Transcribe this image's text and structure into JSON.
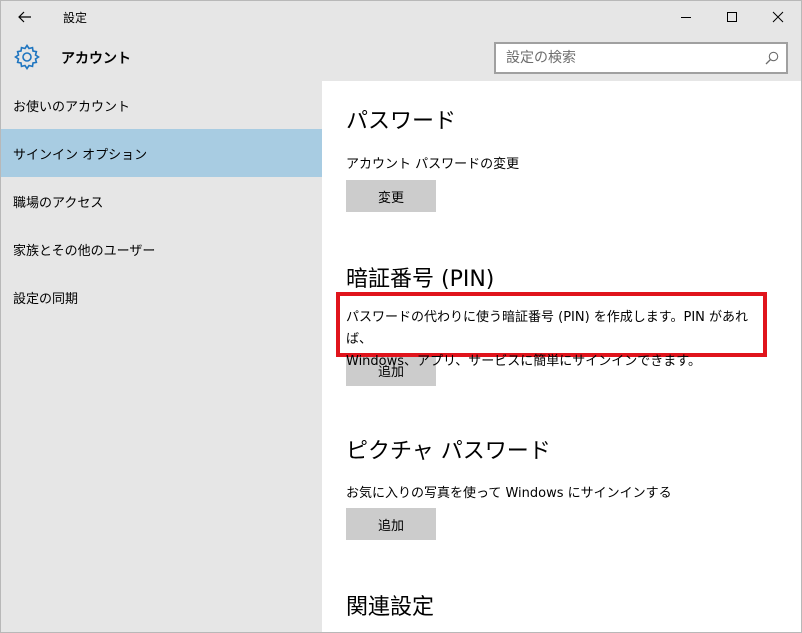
{
  "titlebar": {
    "title": "設定",
    "back_icon": "arrow-left-icon",
    "minimize_icon": "minimize-icon",
    "maximize_icon": "maximize-icon",
    "close_icon": "close-icon"
  },
  "header": {
    "title": "アカウント",
    "icon": "gear-icon",
    "accent_color": "#1e75c0"
  },
  "search": {
    "placeholder": "設定の検索",
    "value": "",
    "icon": "search-icon"
  },
  "sidebar": {
    "items": [
      {
        "label": "お使いのアカウント",
        "selected": false
      },
      {
        "label": "サインイン オプション",
        "selected": true
      },
      {
        "label": "職場のアクセス",
        "selected": false
      },
      {
        "label": "家族とその他のユーザー",
        "selected": false
      },
      {
        "label": "設定の同期",
        "selected": false
      }
    ],
    "selected_color": "#a8cce2"
  },
  "content": {
    "password": {
      "heading": "パスワード",
      "subtitle": "アカウント パスワードの変更",
      "button": "変更"
    },
    "pin": {
      "heading": "暗証番号 (PIN)",
      "description_line1": "パスワードの代わりに使う暗証番号 (PIN) を作成します。PIN があれば、",
      "description_line2": "Windows、アプリ、サービスに簡単にサインインできます。",
      "button": "追加",
      "highlight_color": "#e0141c"
    },
    "picture_password": {
      "heading": "ピクチャ パスワード",
      "subtitle": "お気に入りの写真を使って Windows にサインインする",
      "button": "追加"
    },
    "related": {
      "heading": "関連設定"
    }
  }
}
